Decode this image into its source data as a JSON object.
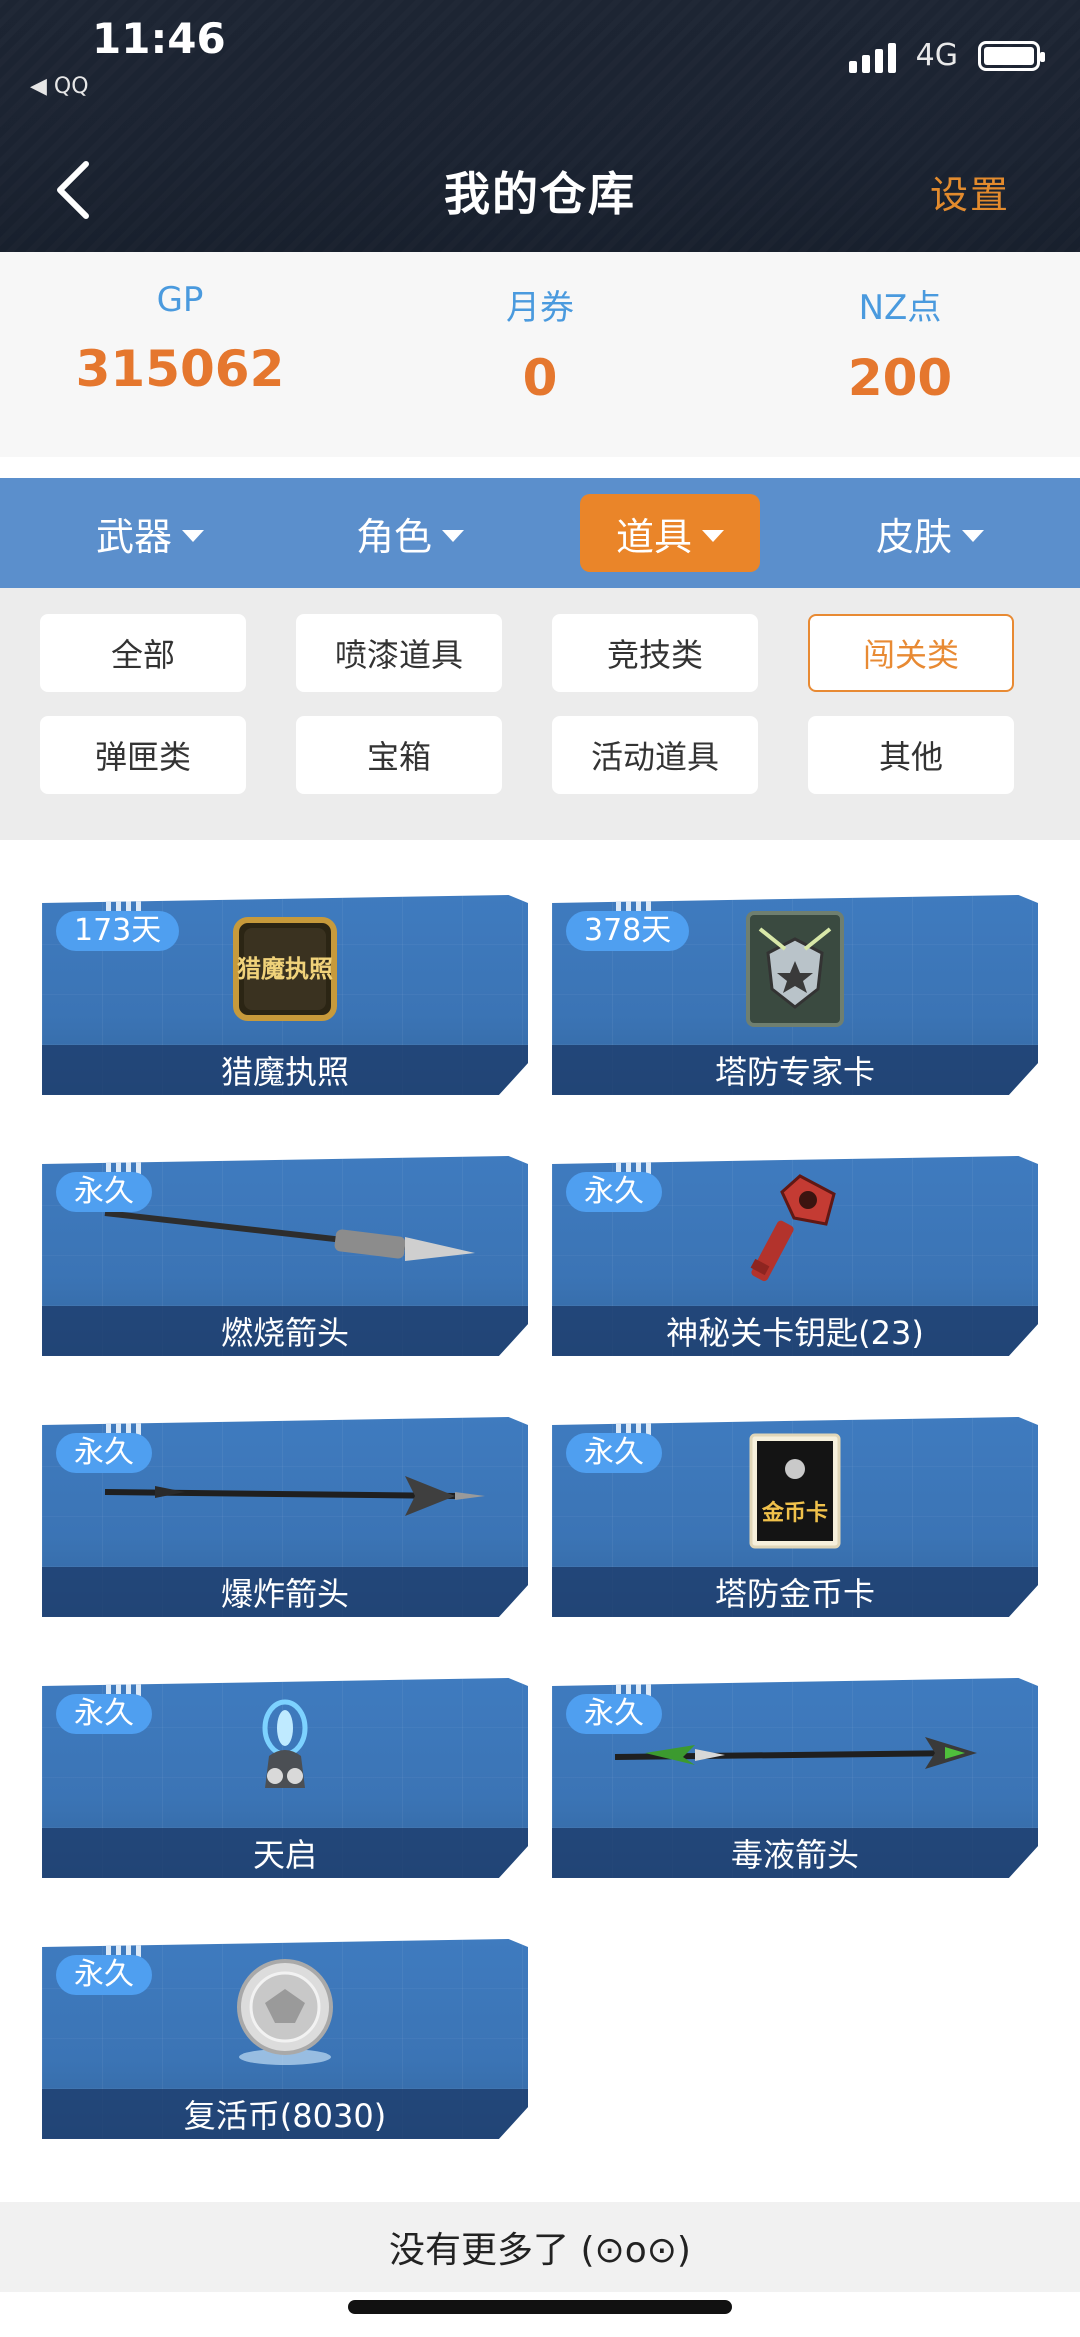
{
  "status": {
    "time": "11:46",
    "back_app": "◀ QQ",
    "network": "4G"
  },
  "nav": {
    "title": "我的仓库",
    "settings": "设置"
  },
  "currency": [
    {
      "label": "GP",
      "value": "315062"
    },
    {
      "label": "月券",
      "value": "0"
    },
    {
      "label": "NZ点",
      "value": "200"
    }
  ],
  "categories": [
    {
      "label": "武器",
      "active": false
    },
    {
      "label": "角色",
      "active": false
    },
    {
      "label": "道具",
      "active": true
    },
    {
      "label": "皮肤",
      "active": false
    }
  ],
  "filters": [
    {
      "label": "全部",
      "active": false
    },
    {
      "label": "喷漆道具",
      "active": false
    },
    {
      "label": "竞技类",
      "active": false
    },
    {
      "label": "闯关类",
      "active": true
    },
    {
      "label": "弹匣类",
      "active": false
    },
    {
      "label": "宝箱",
      "active": false
    },
    {
      "label": "活动道具",
      "active": false
    },
    {
      "label": "其他",
      "active": false
    }
  ],
  "items": [
    {
      "badge": "173天",
      "name": "猎魔执照",
      "icon": "license-icon"
    },
    {
      "badge": "378天",
      "name": "塔防专家卡",
      "icon": "expert-card-icon"
    },
    {
      "badge": "永久",
      "name": "燃烧箭头",
      "icon": "arrow-icon"
    },
    {
      "badge": "永久",
      "name": "神秘关卡钥匙(23)",
      "icon": "key-icon"
    },
    {
      "badge": "永久",
      "name": "爆炸箭头",
      "icon": "arrow-icon"
    },
    {
      "badge": "永久",
      "name": "塔防金币卡",
      "icon": "gold-card-icon"
    },
    {
      "badge": "永久",
      "name": "天启",
      "icon": "orb-icon"
    },
    {
      "badge": "永久",
      "name": "毒液箭头",
      "icon": "arrow-icon"
    },
    {
      "badge": "永久",
      "name": "复活币(8030)",
      "icon": "coin-icon"
    }
  ],
  "footer": {
    "text": "没有更多了 (⊙o⊙)"
  },
  "colors": {
    "accent": "#ea8529",
    "tab_bar": "#5b8fcc",
    "currency_value": "#e5772e",
    "currency_label": "#4a9ade"
  },
  "icons": {
    "license_text": "猎魔执照",
    "gold_card_text": "金币卡"
  }
}
